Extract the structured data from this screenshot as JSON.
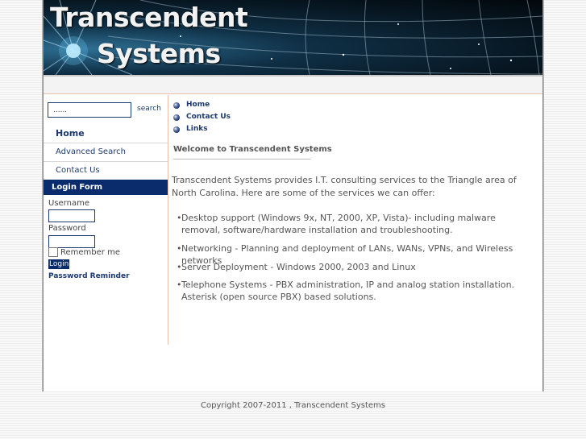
{
  "banner": {
    "title_line1": "Transcendent",
    "title_line2": "Systems"
  },
  "sidebar": {
    "search_value": "......",
    "search_label": "search",
    "nav_items": [
      {
        "label": "Home"
      },
      {
        "label": "Advanced Search"
      },
      {
        "label": "Contact Us"
      }
    ],
    "login_form": {
      "title": "Login Form",
      "username_label": "Username",
      "password_label": "Password",
      "remember_label": "Remember me",
      "login_button": "Login",
      "password_reminder": "Password Reminder"
    }
  },
  "content": {
    "top_nav": [
      {
        "label": "Home",
        "icon": "bullet-icon"
      },
      {
        "label": "Contact Us",
        "icon": "bullet-icon"
      },
      {
        "label": "Links",
        "icon": "bullet-icon"
      }
    ],
    "welcome_title": "Welcome to Transcendent Systems",
    "intro": "Transcendent Systems provides I.T. consulting services to the Triangle area of North Carolina. Here are some of the services we can offer:",
    "services": [
      "Desktop support (Windows 9x, NT, 2000, XP, Vista)- including malware removal, software/hardware installation and troubleshooting.",
      "Networking - Planning and deployment of LANs, WANs, VPNs, and Wireless networks",
      "Server Deployment - Windows 2000, 2003 and Linux",
      "Telephone Systems - PBX administration, IP and analog station installation. Asterisk (open source PBX) based solutions."
    ]
  },
  "footer": {
    "copyright": "Copyright 2007-2011 , Transcendent Systems"
  },
  "colors": {
    "nav_blue": "#1c3a6e",
    "login_header_bg": "#0b2c6c",
    "divider_peach": "#e8c1a8"
  }
}
